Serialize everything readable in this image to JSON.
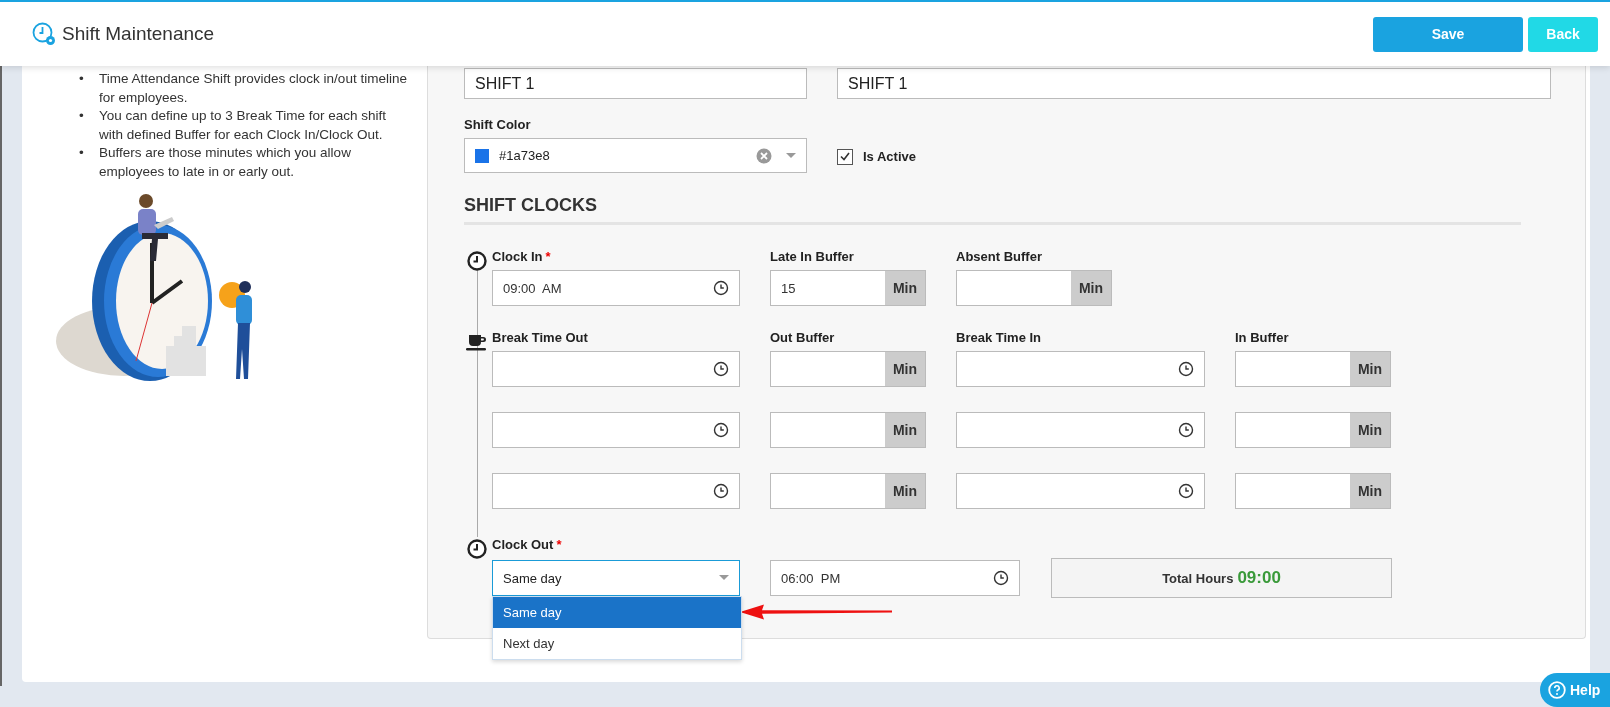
{
  "header": {
    "title": "Shift Maintenance",
    "buttons": [
      {
        "label": "Save",
        "kind": "primary"
      },
      {
        "label": "Back",
        "kind": "secondary"
      }
    ]
  },
  "info": {
    "bullets": [
      {
        "marker": "•",
        "text": "Time Attendance Shift provides clock in/out timeline for employees."
      },
      {
        "marker": "•",
        "text": "You can define up to 3 Break Time for each shift with defined Buffer for each Clock In/Clock Out."
      },
      {
        "marker": "•",
        "text": "Buffers are those minutes which you allow employees to late in or early out."
      }
    ]
  },
  "form": {
    "name_fields": [
      {
        "value": "SHIFT 1"
      },
      {
        "value": "SHIFT 1"
      }
    ],
    "shift_color": {
      "label": "Shift Color",
      "value": "#1a73e8",
      "color": "#1a73e8"
    },
    "is_active": {
      "label": "Is Active",
      "checked": true
    },
    "section_title": "SHIFT CLOCKS",
    "clock_in": {
      "label": "Clock In",
      "required_mark": "*",
      "value": "09:00  AM"
    },
    "late_in_buffer": {
      "label": "Late In Buffer",
      "value": "15",
      "unit": "Min"
    },
    "absent_buffer": {
      "label": "Absent Buffer",
      "unit": "Min"
    },
    "break_labels": [
      "Break Time Out",
      "Out Buffer",
      "Break Time In",
      "In Buffer"
    ],
    "break_rows": [
      {
        "out_unit": "Min",
        "in_unit": "Min"
      },
      {
        "out_unit": "Min",
        "in_unit": "Min"
      },
      {
        "out_unit": "Min",
        "in_unit": "Min"
      }
    ],
    "clock_out": {
      "label": "Clock Out",
      "required_mark": "*",
      "day_select": {
        "value": "Same day",
        "open": true,
        "options": [
          {
            "label": "Same day",
            "selected": true
          },
          {
            "label": "Next day",
            "selected": false
          }
        ]
      },
      "time": "06:00  PM"
    },
    "total_hours": {
      "label": "Total Hours",
      "value": "09:00"
    }
  },
  "help": {
    "label": "Help"
  }
}
